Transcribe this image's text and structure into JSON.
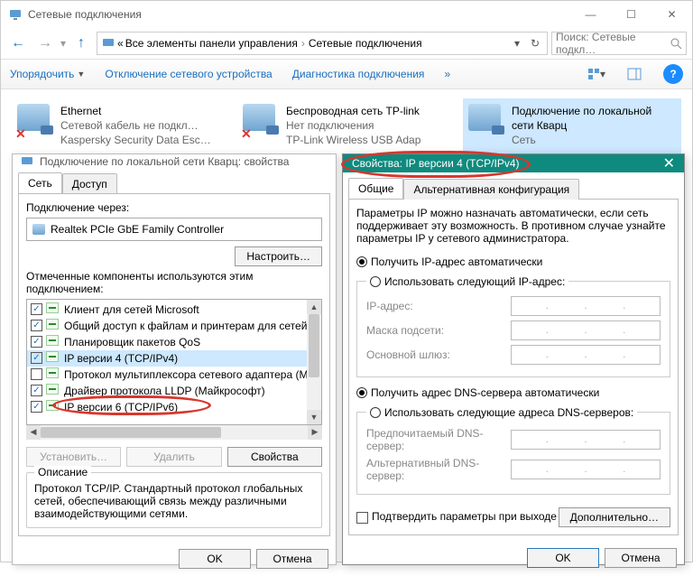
{
  "window": {
    "title": "Сетевые подключения"
  },
  "titlebar_controls": {
    "min": "—",
    "max": "☐",
    "close": "✕"
  },
  "nav": {
    "back": "←",
    "fwd": "→",
    "up": "↑"
  },
  "breadcrumb": {
    "root_glyph": "«",
    "item1": "Все элементы панели управления",
    "item2": "Сетевые подключения",
    "sep": "›"
  },
  "search": {
    "placeholder": "Поиск: Сетевые подкл…"
  },
  "cmdbar": {
    "organize": "Упорядочить",
    "disable": "Отключение сетевого устройства",
    "diagnose": "Диагностика подключения",
    "more": "»"
  },
  "connections": [
    {
      "name": "Ethernet",
      "line2": "Сетевой кабель не подкл…",
      "line3": "Kaspersky Security Data Esc…"
    },
    {
      "name": "Беспроводная сеть TP-link",
      "line2": "Нет подключения",
      "line3": "TP-Link Wireless USB Adap"
    },
    {
      "name": "Подключение по локальной сети Кварц",
      "line2": "Сеть",
      "line3": ""
    }
  ],
  "dlg1": {
    "title": "Подключение по локальной сети Кварц: свойства",
    "tabs": {
      "net": "Сеть",
      "access": "Доступ"
    },
    "connect_via": "Подключение через:",
    "adapter": "Realtek PCIe GbE Family Controller",
    "configure": "Настроить…",
    "components_label": "Отмеченные компоненты используются этим подключением:",
    "components": [
      {
        "checked": true,
        "label": "Клиент для сетей Microsoft"
      },
      {
        "checked": true,
        "label": "Общий доступ к файлам и принтерам для сетей Mi"
      },
      {
        "checked": true,
        "label": "Планировщик пакетов QoS"
      },
      {
        "checked": true,
        "label": "IP версии 4 (TCP/IPv4)",
        "highlight": true
      },
      {
        "checked": false,
        "label": "Протокол мультиплексора сетевого адаптера (Ма"
      },
      {
        "checked": true,
        "label": "Драйвер протокола LLDP (Майкрософт)"
      },
      {
        "checked": true,
        "label": "IP версии 6 (TCP/IPv6)"
      }
    ],
    "install": "Установить…",
    "remove": "Удалить",
    "props": "Свойства",
    "desc_title": "Описание",
    "desc_body": "Протокол TCP/IP. Стандартный протокол глобальных сетей, обеспечивающий связь между различными взаимодействующими сетями.",
    "ok": "OK",
    "cancel": "Отмена"
  },
  "dlg2": {
    "title": "Свойства: IP версии 4 (TCP/IPv4)",
    "close": "✕",
    "tabs": {
      "general": "Общие",
      "alt": "Альтернативная конфигурация"
    },
    "intro": "Параметры IP можно назначать автоматически, если сеть поддерживает эту возможность. В противном случае узнайте параметры IP у сетевого администратора.",
    "auto_ip": "Получить IP-адрес автоматически",
    "manual_ip": "Использовать следующий IP-адрес:",
    "ip_label": "IP-адрес:",
    "mask_label": "Маска подсети:",
    "gw_label": "Основной шлюз:",
    "auto_dns": "Получить адрес DNS-сервера автоматически",
    "manual_dns": "Использовать следующие адреса DNS-серверов:",
    "dns1": "Предпочитаемый DNS-сервер:",
    "dns2": "Альтернативный DNS-сервер:",
    "confirm_exit": "Подтвердить параметры при выходе",
    "advanced": "Дополнительно…",
    "ok": "OK",
    "cancel": "Отмена"
  }
}
